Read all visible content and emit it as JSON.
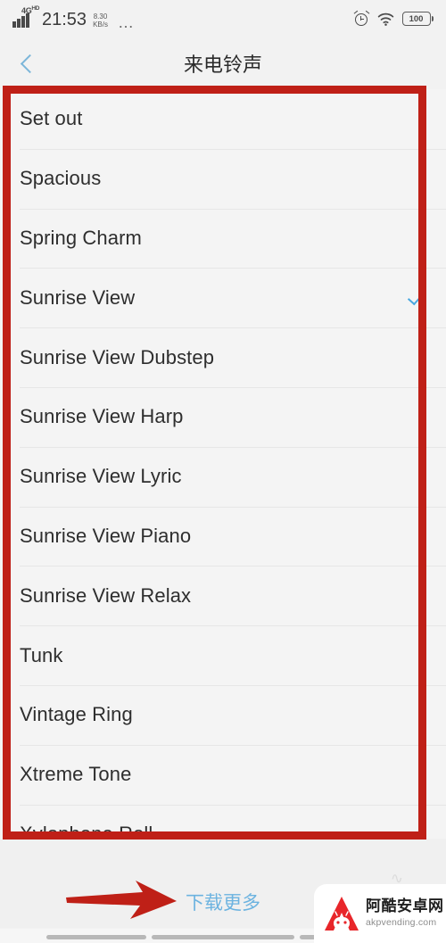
{
  "status_bar": {
    "network_type": "4G",
    "network_suffix": "HD",
    "signal_icon": "signal-bars-icon",
    "time": "21:53",
    "net_speed_value": "8.30",
    "net_speed_unit": "KB/s",
    "more_icon": "ellipsis-icon",
    "alarm_icon": "alarm-clock-icon",
    "wifi_icon": "wifi-icon",
    "battery_level": "100",
    "battery_icon": "battery-icon"
  },
  "app_bar": {
    "back_icon": "chevron-left-icon",
    "title": "来电铃声"
  },
  "ringtone_list": {
    "selected": "Sunrise View",
    "check_icon": "check-icon",
    "check_color": "#49a8e0",
    "items": [
      {
        "label": "Set out",
        "selected": false
      },
      {
        "label": "Spacious",
        "selected": false
      },
      {
        "label": "Spring Charm",
        "selected": false
      },
      {
        "label": "Sunrise View",
        "selected": true
      },
      {
        "label": "Sunrise View Dubstep",
        "selected": false
      },
      {
        "label": "Sunrise View Harp",
        "selected": false
      },
      {
        "label": "Sunrise View Lyric",
        "selected": false
      },
      {
        "label": "Sunrise View Piano",
        "selected": false
      },
      {
        "label": "Sunrise View Relax",
        "selected": false
      },
      {
        "label": "Tunk",
        "selected": false
      },
      {
        "label": "Vintage Ring",
        "selected": false
      },
      {
        "label": "Xtreme Tone",
        "selected": false
      },
      {
        "label": "Xylophone Roll",
        "selected": false
      }
    ]
  },
  "annotations": {
    "box_color": "#bf2017",
    "arrow_color": "#bf2017",
    "arrow_icon": "arrow-right-annotation"
  },
  "footer": {
    "download_more_label": "下载更多",
    "download_more_color": "#6cb3e0"
  },
  "watermark": {
    "logo_icon": "android-a-logo-icon",
    "site_name_cn": "阿酷安卓网",
    "site_url": "akpvending.com"
  },
  "nav_bar": {
    "back_pill": "nav-pill-back",
    "home_pill": "nav-pill-home",
    "recents_pill": "nav-pill-recents"
  }
}
